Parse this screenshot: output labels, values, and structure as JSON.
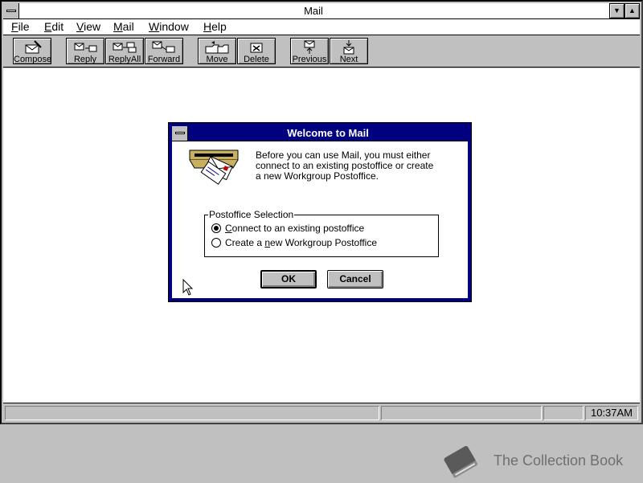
{
  "window": {
    "title": "Mail"
  },
  "menu": {
    "items": [
      {
        "mnemonic": "F",
        "rest": "ile"
      },
      {
        "mnemonic": "E",
        "rest": "dit"
      },
      {
        "mnemonic": "V",
        "rest": "iew"
      },
      {
        "mnemonic": "M",
        "rest": "ail"
      },
      {
        "mnemonic": "W",
        "rest": "indow"
      },
      {
        "mnemonic": "H",
        "rest": "elp"
      }
    ]
  },
  "toolbar": {
    "buttons": [
      {
        "label": "Compose",
        "icon": "compose-icon"
      },
      {
        "label": "Reply",
        "icon": "reply-icon"
      },
      {
        "label": "ReplyAll",
        "icon": "reply-all-icon"
      },
      {
        "label": "Forward",
        "icon": "forward-icon"
      },
      {
        "label": "Move",
        "icon": "move-icon"
      },
      {
        "label": "Delete",
        "icon": "delete-icon"
      },
      {
        "label": "Previous",
        "icon": "previous-icon"
      },
      {
        "label": "Next",
        "icon": "next-icon"
      }
    ]
  },
  "status": {
    "time": "10:37AM"
  },
  "dialog": {
    "title": "Welcome to Mail",
    "message_lines": [
      "Before you can use Mail, you must either",
      "connect to an existing postoffice or create",
      "a new Workgroup Postoffice."
    ],
    "group_label": "Postoffice Selection",
    "options": [
      {
        "pre": "",
        "mn": "C",
        "post": "onnect to an existing postoffice",
        "checked": true
      },
      {
        "pre": "Create a ",
        "mn": "n",
        "post": "ew Workgroup Postoffice",
        "checked": false
      }
    ],
    "ok_label": "OK",
    "cancel_label": "Cancel"
  },
  "watermark": {
    "text": "The Collection Book"
  },
  "colors": {
    "active_title": "#000080",
    "face": "#c0c0c0",
    "workspace": "#ffffff"
  }
}
